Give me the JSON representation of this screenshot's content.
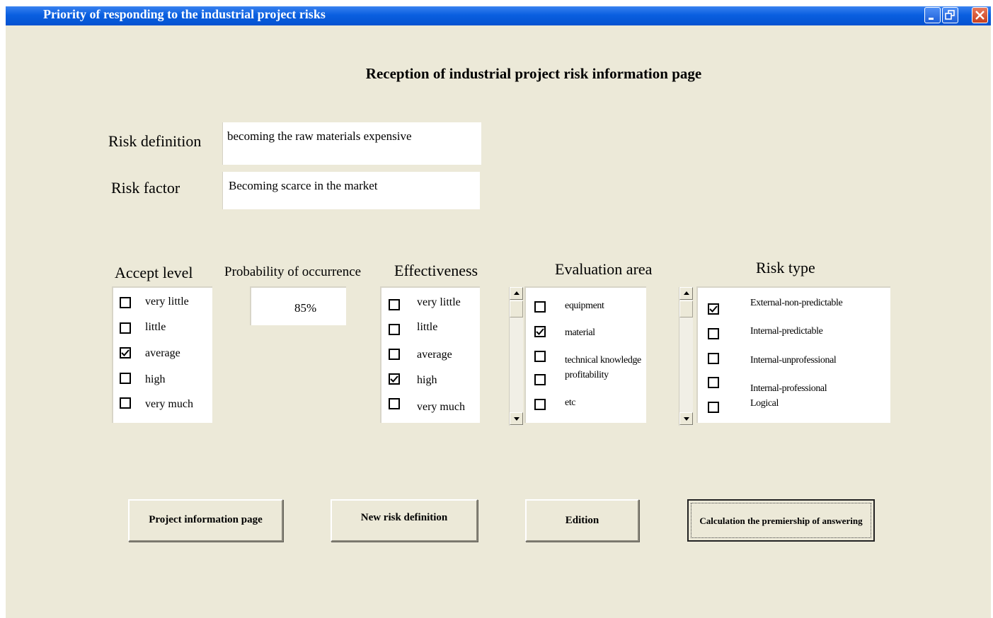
{
  "window": {
    "title": "Priority of responding to the industrial project risks",
    "controls": [
      "minimize-icon",
      "restore-icon",
      "close-icon"
    ]
  },
  "page": {
    "heading": "Reception of industrial project risk information page"
  },
  "fields": {
    "risk_definition": {
      "label": "Risk definition",
      "value": "becoming the raw materials expensive"
    },
    "risk_factor": {
      "label": "Risk factor",
      "value": "Becoming scarce in the market"
    }
  },
  "accept_level": {
    "label": "Accept level",
    "items": [
      {
        "text": "very little",
        "checked": false
      },
      {
        "text": "little",
        "checked": false
      },
      {
        "text": "average",
        "checked": true
      },
      {
        "text": "high",
        "checked": false
      },
      {
        "text": "very much",
        "checked": false
      }
    ]
  },
  "probability": {
    "label": "Probability of occurrence",
    "value": "85%"
  },
  "effectiveness": {
    "label": "Effectiveness",
    "items": [
      {
        "text": "very little",
        "checked": false
      },
      {
        "text": "little",
        "checked": false
      },
      {
        "text": "average",
        "checked": false
      },
      {
        "text": "high",
        "checked": true
      },
      {
        "text": "very much",
        "checked": false
      }
    ]
  },
  "evaluation_area": {
    "label": "Evaluation area",
    "items": [
      {
        "text": "equipment",
        "checked": false
      },
      {
        "text": "material",
        "checked": true
      },
      {
        "text": "technical knowledge",
        "checked": false
      },
      {
        "text": "profitability",
        "checked": false
      },
      {
        "text": "etc",
        "checked": false
      }
    ]
  },
  "risk_type": {
    "label": "Risk type",
    "items": [
      {
        "text": "External-non-predictable",
        "checked": true
      },
      {
        "text": "Internal-predictable",
        "checked": false
      },
      {
        "text": "Internal-unprofessional",
        "checked": false
      },
      {
        "text": "Internal-professional",
        "checked": false
      },
      {
        "text": "Logical",
        "checked": false
      }
    ]
  },
  "buttons": {
    "project_info": "Project information page",
    "new_risk": "New risk definition",
    "edition": "Edition",
    "calculate": "Calculation the premiership of answering"
  },
  "colors": {
    "window_bg": "#ece9d8",
    "titlebar": "#0a5fe0",
    "close_button": "#c8401f"
  }
}
